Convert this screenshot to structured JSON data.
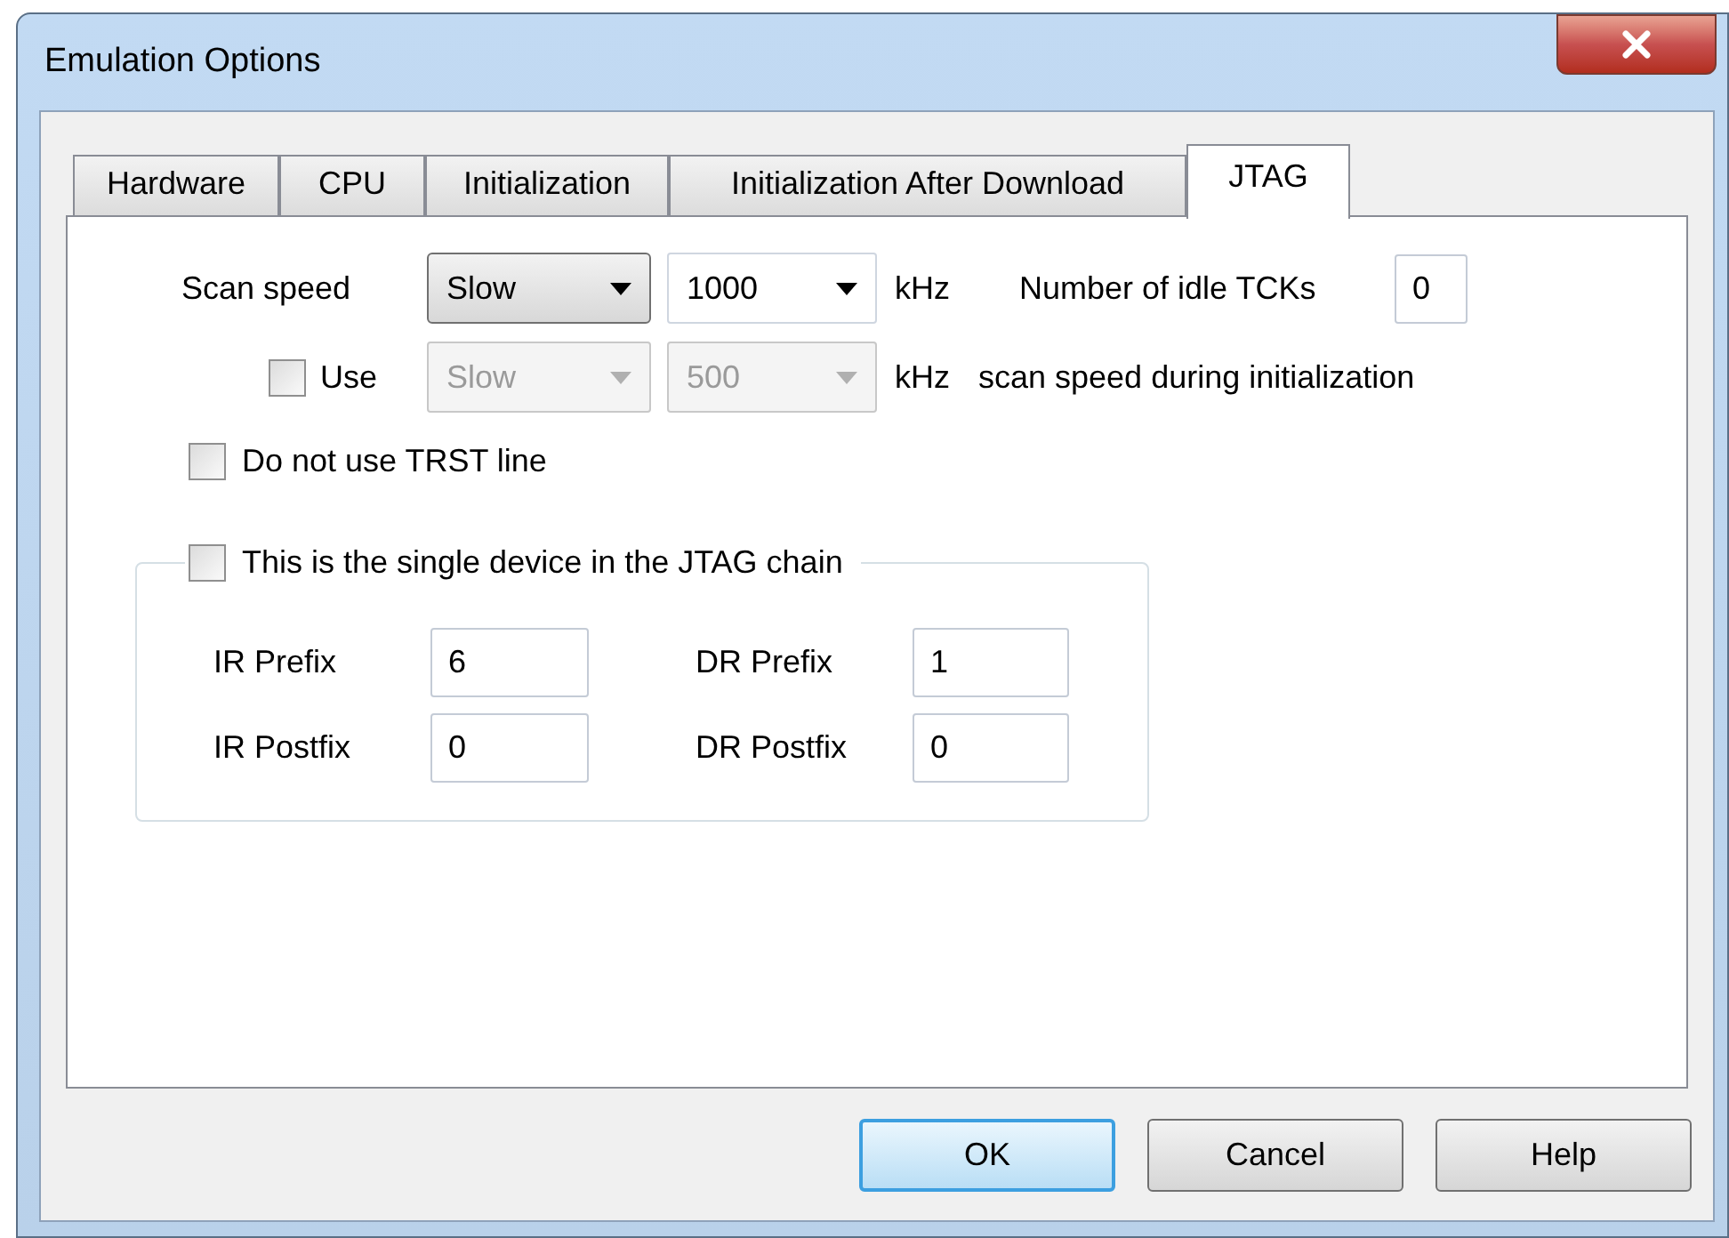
{
  "window": {
    "title": "Emulation Options"
  },
  "tabs": [
    {
      "label": "Hardware",
      "selected": false
    },
    {
      "label": "CPU",
      "selected": false
    },
    {
      "label": "Initialization",
      "selected": false
    },
    {
      "label": "Initialization After Download",
      "selected": false
    },
    {
      "label": "JTAG",
      "selected": true
    }
  ],
  "scan_speed": {
    "label": "Scan speed",
    "speed": "Slow",
    "frequency": "1000",
    "unit": "kHz",
    "idle_label": "Number of idle TCKs",
    "idle_value": "0"
  },
  "init_speed": {
    "checked": false,
    "label": "Use",
    "speed": "Slow",
    "frequency": "500",
    "unit": "kHz",
    "suffix": "scan speed during initialization",
    "disabled": true
  },
  "trst": {
    "checked": false,
    "label": "Do not use TRST line"
  },
  "single_device": {
    "checked": false,
    "label": "This is the single device in the JTAG chain",
    "fields": [
      {
        "label": "IR Prefix",
        "value": "6"
      },
      {
        "label": "DR Prefix",
        "value": "1"
      },
      {
        "label": "IR Postfix",
        "value": "0"
      },
      {
        "label": "DR Postfix",
        "value": "0"
      }
    ]
  },
  "buttons": [
    {
      "label": "OK",
      "default": true
    },
    {
      "label": "Cancel",
      "default": false
    },
    {
      "label": "Help",
      "default": false
    }
  ]
}
